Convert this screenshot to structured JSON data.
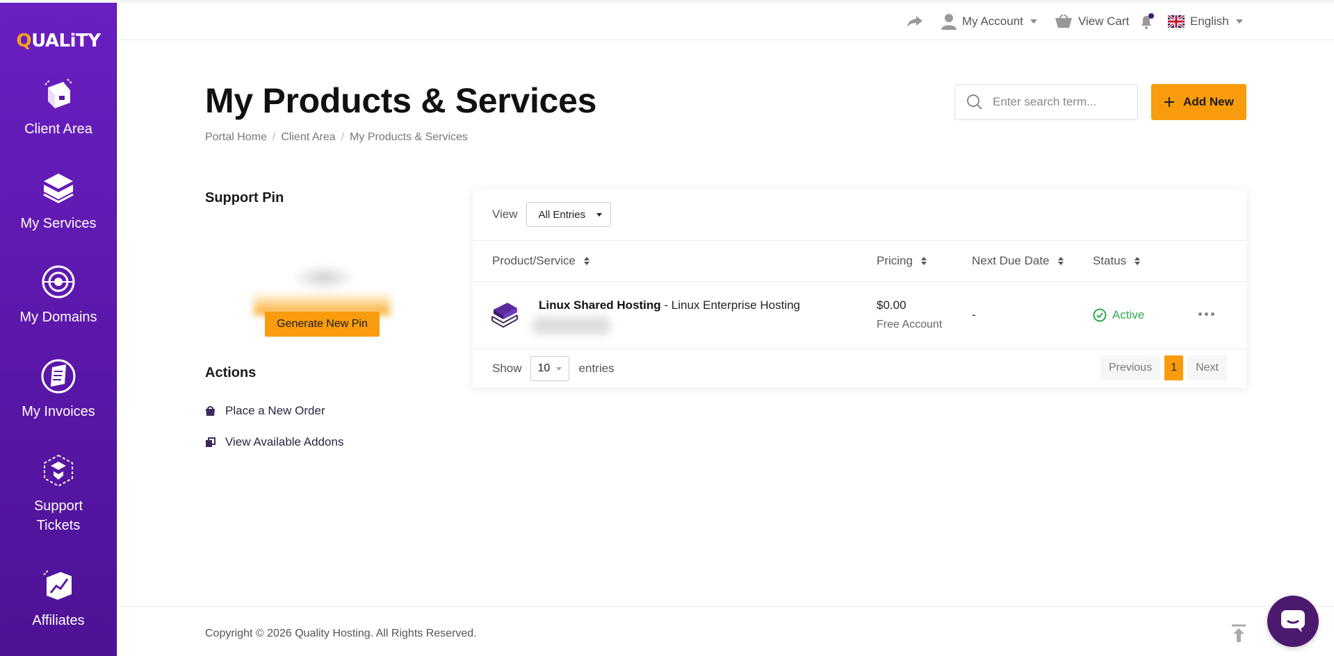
{
  "brand": {
    "logo_text_q": "Q",
    "logo_text_rest": "UALiTY"
  },
  "sidebar": {
    "items": [
      {
        "label": "Client Area",
        "icon": "client-area-icon"
      },
      {
        "label": "My Services",
        "icon": "services-icon"
      },
      {
        "label": "My Domains",
        "icon": "domains-icon"
      },
      {
        "label": "My Invoices",
        "icon": "invoices-icon"
      },
      {
        "label": "Support Tickets",
        "icon": "support-tickets-icon"
      },
      {
        "label": "Affiliates",
        "icon": "affiliates-icon"
      }
    ]
  },
  "topbar": {
    "account_label": "My Account",
    "cart_label": "View Cart",
    "language_label": "English"
  },
  "header": {
    "title": "My Products & Services",
    "breadcrumb": [
      "Portal Home",
      "Client Area",
      "My Products & Services"
    ],
    "search_placeholder": "Enter search term...",
    "add_new_label": "Add New"
  },
  "support_pin": {
    "title": "Support Pin",
    "generate_label": "Generate New Pin"
  },
  "actions": {
    "title": "Actions",
    "items": [
      "Place a New Order",
      "View Available Addons"
    ]
  },
  "table": {
    "view_label": "View",
    "view_filter": "All Entries",
    "columns": [
      "Product/Service",
      "Pricing",
      "Next Due Date",
      "Status"
    ],
    "rows": [
      {
        "product": "Linux Shared Hosting",
        "product_suffix": " - Linux Enterprise Hosting",
        "price": "$0.00",
        "billing": "Free Account",
        "due": "-",
        "status": "Active"
      }
    ],
    "show_label": "Show",
    "page_length": "10",
    "entries_label": "entries",
    "pagination": {
      "previous": "Previous",
      "current": "1",
      "next": "Next"
    }
  },
  "footer": {
    "copyright": "Copyright © 2026 Quality Hosting. All Rights Reserved."
  },
  "colors": {
    "sidebar": "#5a17a8",
    "accent": "#f89c0e",
    "status_active": "#2daa4f",
    "chat": "#4b1a6e"
  }
}
